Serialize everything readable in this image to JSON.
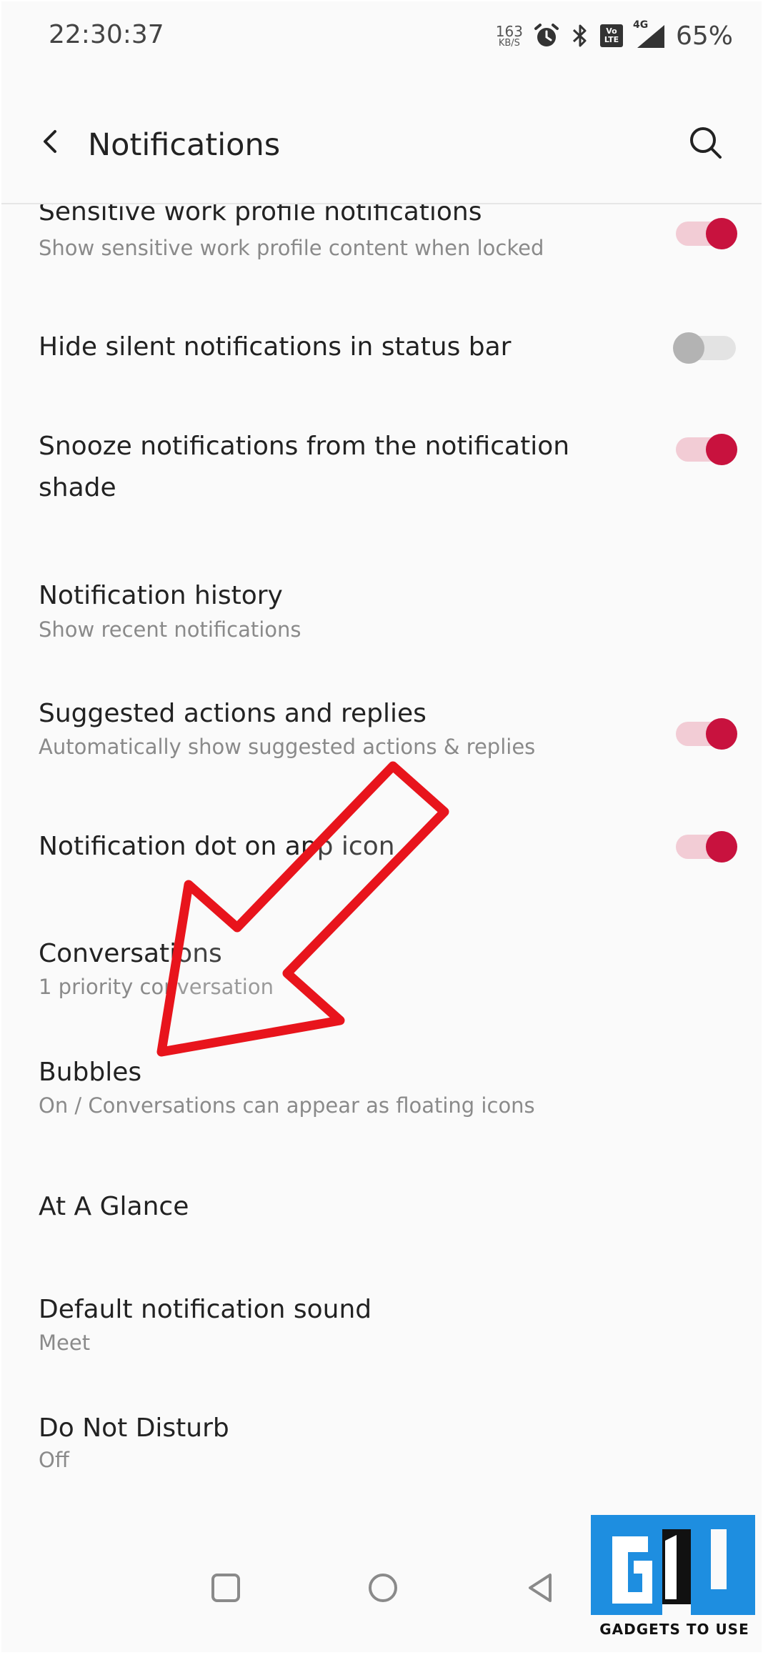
{
  "status_bar": {
    "time": "22:30:37",
    "net_speed_value": "163",
    "net_speed_unit": "KB/S",
    "volte_top": "Vo",
    "volte_bottom": "LTE",
    "network_type": "4G",
    "battery": "65%"
  },
  "app_bar": {
    "title": "Notifications"
  },
  "settings": [
    {
      "title": "Sensitive work profile notifications",
      "subtitle": "Show sensitive work profile content when locked",
      "toggle": "on"
    },
    {
      "title": "Hide silent notifications in status bar",
      "toggle": "off"
    },
    {
      "title": "Snooze notifications from the notification shade",
      "toggle": "on"
    },
    {
      "title": "Notification history",
      "subtitle": "Show recent notifications"
    },
    {
      "title": "Suggested actions and replies",
      "subtitle": "Automatically show suggested actions & replies",
      "toggle": "on"
    },
    {
      "title": "Notification dot on app icon",
      "toggle": "on"
    },
    {
      "title": "Conversations",
      "subtitle": "1 priority conversation"
    },
    {
      "title": "Bubbles",
      "subtitle": "On / Conversations can appear as floating icons"
    },
    {
      "title": "At A Glance"
    },
    {
      "title": "Default notification sound",
      "subtitle": "Meet"
    },
    {
      "title": "Do Not Disturb",
      "subtitle": "Off"
    }
  ],
  "watermark": {
    "text": "GADGETS TO USE"
  },
  "colors": {
    "accent": "#c8123e",
    "toggle_track_on": "#f2ccd5",
    "annotation_arrow": "#e8141c"
  }
}
